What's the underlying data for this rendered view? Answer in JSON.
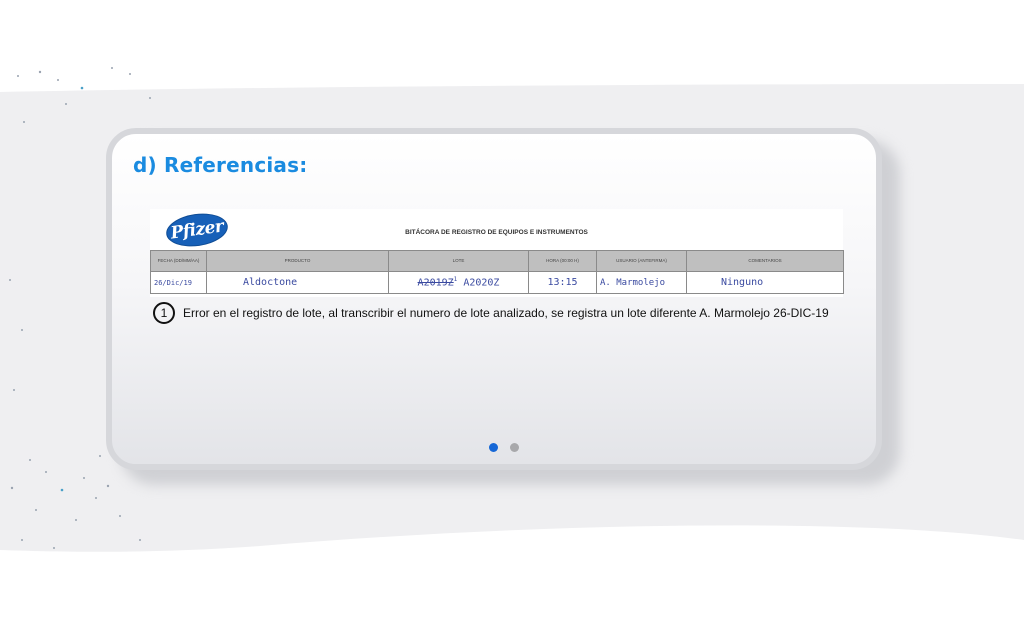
{
  "slide": {
    "title": "d) Referencias:"
  },
  "document": {
    "logo_text": "Pfizer",
    "title": "BITÁCORA DE REGISTRO DE EQUIPOS E INSTRUMENTOS",
    "columns": [
      "FECHA (DD/MM/AA)",
      "PRODUCTO",
      "LOTE",
      "HORA (00:00 h)",
      "USUARIO (ANTEFIRMA)",
      "COMENTARIOS"
    ],
    "row": {
      "date": "26/Dic/19",
      "product": "Aldoctone",
      "lot_crossed": "A2019Z",
      "lot_mark": "1",
      "lot_correct": "A2020Z",
      "time": "13:15",
      "user": "A. Marmolejo",
      "comments": "Ninguno"
    }
  },
  "note": {
    "number": "1",
    "text": "Error en el registro de lote, al transcribir el numero de lote analizado, se registra un lote diferente A. Marmolejo 26-DIC-19"
  },
  "pager": {
    "total": 2,
    "active_index": 0,
    "active_color": "#1667d6",
    "inactive_color": "#a8a8ab"
  },
  "colors": {
    "title": "#1a8be0",
    "handwriting": "#3a4aa0",
    "logo": "#1760b8"
  }
}
